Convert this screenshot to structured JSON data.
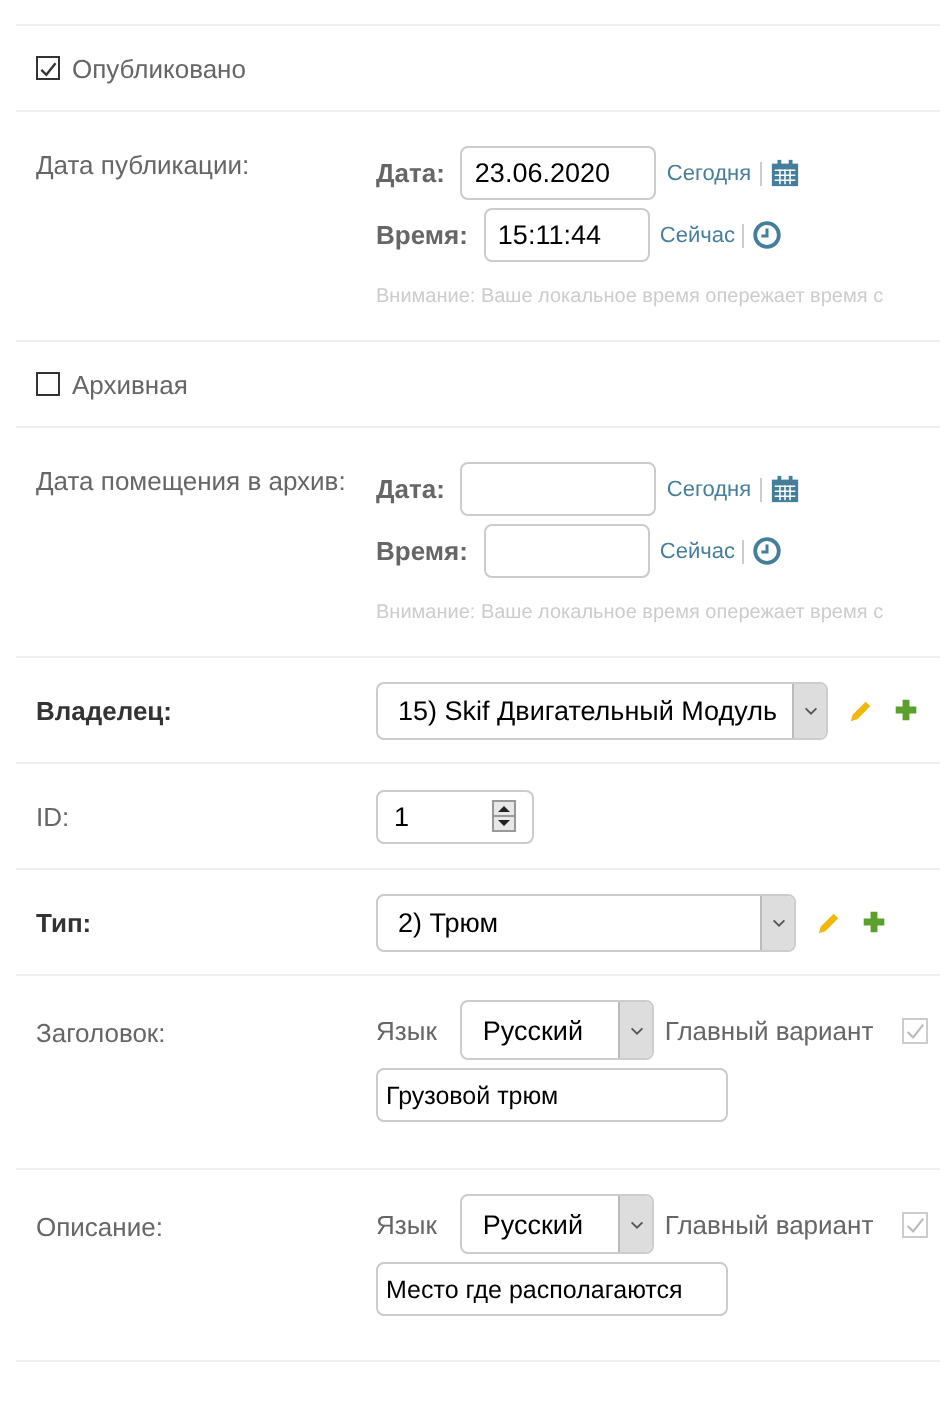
{
  "rows": [
    {
      "kind": "checkbox",
      "label": "Опубликовано",
      "checked": true
    },
    {
      "kind": "datetime",
      "label": "Дата публикации:",
      "required": false,
      "date_label": "Дата:",
      "date_value": "23.06.2020",
      "today_link": "Сегодня",
      "time_label": "Время:",
      "time_value": "15:11:44",
      "now_link": "Сейчас",
      "warning": "Внимание: Ваше локальное время опережает время с"
    },
    {
      "kind": "checkbox",
      "label": "Архивная",
      "checked": false
    },
    {
      "kind": "datetime",
      "label": "Дата помещения в архив:",
      "required": false,
      "date_label": "Дата:",
      "today_link": "Сегодня",
      "time_label": "Время:",
      "now_link": "Сейчас",
      "warning": "Внимание: Ваше локальное время опережает время с"
    },
    {
      "kind": "select",
      "label": "Владелец:",
      "required": true,
      "value": "15) Skif Двигательный Модуль",
      "wide": true
    },
    {
      "kind": "number",
      "label": "ID:",
      "required": false,
      "value": "1"
    },
    {
      "kind": "select",
      "label": "Тип:",
      "required": true,
      "value": "2) Трюм",
      "wide": false
    },
    {
      "kind": "translated",
      "label": "Заголовок:",
      "required": false,
      "lang_label": "Язык",
      "lang_value": "Русский",
      "main_label": "Главный вариант",
      "main_checked": true,
      "text": "Грузовой трюм"
    },
    {
      "kind": "translated",
      "label": "Описание:",
      "required": false,
      "lang_label": "Язык",
      "lang_value": "Русский",
      "main_label": "Главный вариант",
      "main_checked": true,
      "text": "Место где располагаются"
    }
  ]
}
